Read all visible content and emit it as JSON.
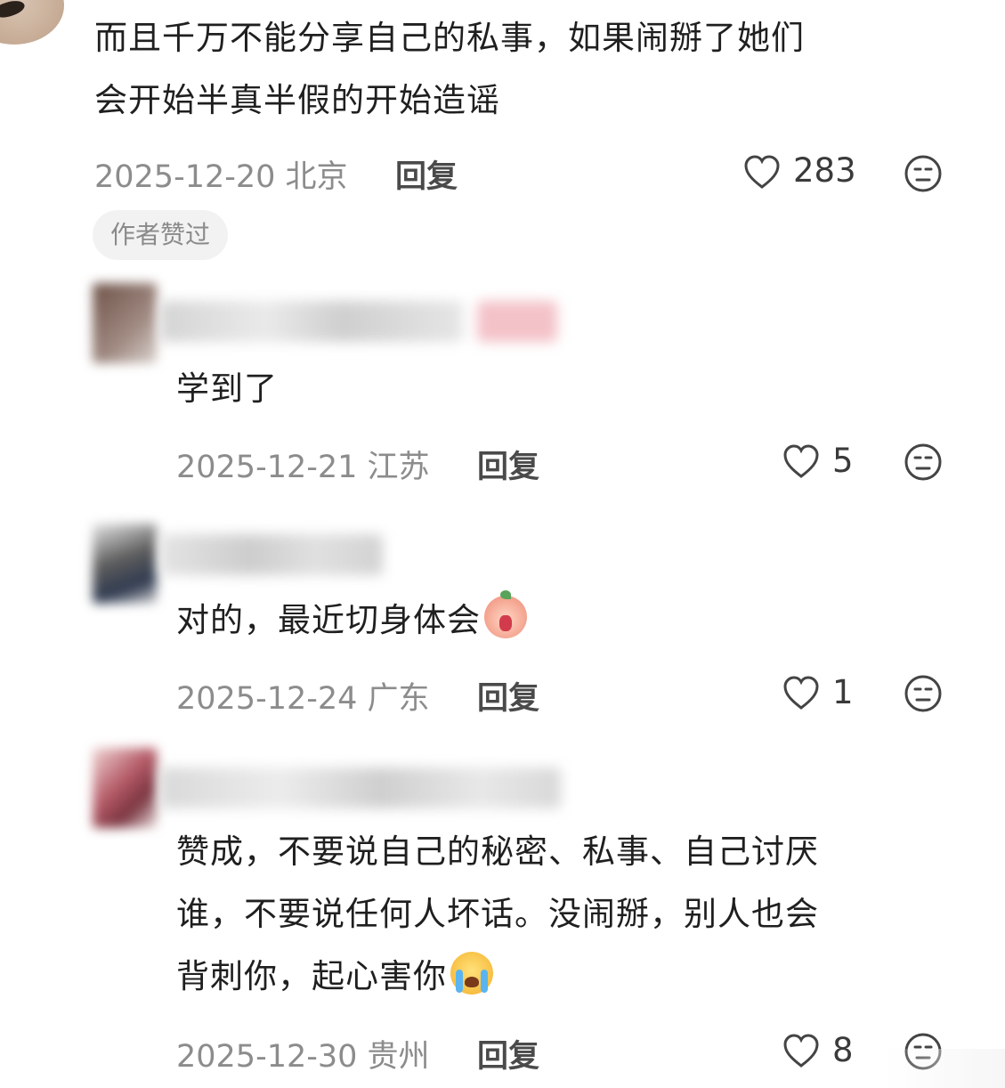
{
  "comments": [
    {
      "lines": [
        "而且千万不能分享自己的私事，如果闹掰了她们",
        "会开始半真半假的开始造谣"
      ],
      "date": "2025-12-20",
      "location": "北京",
      "reply_label": "回复",
      "likes": "283",
      "badge": "作者赞过"
    },
    {
      "lines": [
        "学到了"
      ],
      "date": "2025-12-21",
      "location": "江苏",
      "reply_label": "回复",
      "likes": "5"
    },
    {
      "lines": [
        "对的，最近切身体会"
      ],
      "date": "2025-12-24",
      "location": "广东",
      "reply_label": "回复",
      "likes": "1"
    },
    {
      "lines": [
        "赞成，不要说自己的秘密、私事、自己讨厌",
        "谁，不要说任何人坏话。没闹掰，别人也会",
        "背刺你，起心害你"
      ],
      "date": "2025-12-30",
      "location": "贵州",
      "reply_label": "回复",
      "likes": "8"
    }
  ],
  "icons": {
    "like": "heart-outline-icon",
    "dislike": "neutral-face-icon",
    "emoji_1": "crying-peach-emoji",
    "emoji_2": "loudly-crying-face-emoji"
  },
  "colors": {
    "text": "#1f1f1f",
    "meta": "#8c8c8c",
    "badge_bg": "#f2f2f2"
  }
}
